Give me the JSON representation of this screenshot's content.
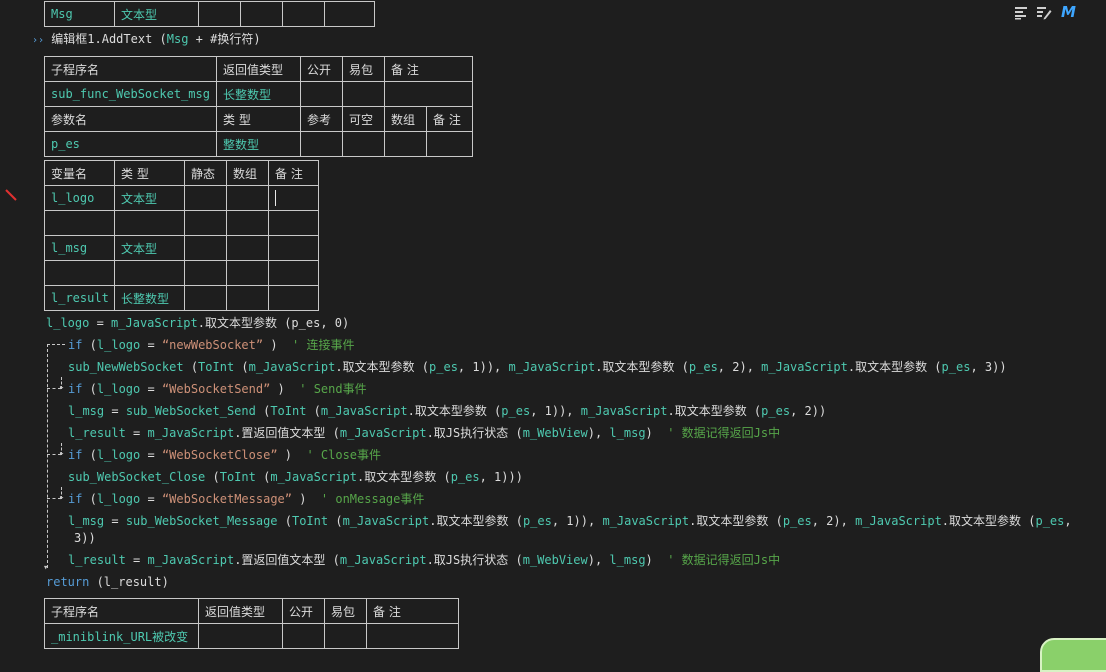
{
  "top_table": {
    "name": "Msg",
    "type": "文本型"
  },
  "addtext_line": {
    "arrow": "››",
    "obj": "编辑框1.AddText",
    "open": " (",
    "arg1": "Msg",
    "plus": " + ",
    "arg2": "#换行符",
    "close": ")"
  },
  "sub_table": {
    "headers": [
      "子程序名",
      "返回值类型",
      "公开",
      "易包",
      "备 注"
    ],
    "name": "sub_func_WebSocket_msg",
    "return_type": "长整数型",
    "param_headers": [
      "参数名",
      "类 型",
      "参考",
      "可空",
      "数组",
      "备 注"
    ],
    "param_name": "p_es",
    "param_type": "整数型"
  },
  "var_table": {
    "headers": [
      "变量名",
      "类 型",
      "静态",
      "数组",
      "备 注"
    ],
    "rows": [
      {
        "name": "l_logo",
        "type": "文本型"
      },
      {
        "name": "",
        "type": ""
      },
      {
        "name": "l_msg",
        "type": "文本型"
      },
      {
        "name": "",
        "type": ""
      },
      {
        "name": "l_result",
        "type": "长整数型"
      }
    ]
  },
  "code": {
    "l1": {
      "v": "l_logo",
      "eq": " = ",
      "obj": "m_JavaScript",
      "m": ".取文本型参数",
      "args": " (p_es, 0)"
    },
    "l2": {
      "kw": "if",
      "open": " (",
      "v": "l_logo",
      "eq": " = ",
      "s": "“newWebSocket”",
      "close": " ) ",
      "c": " ' 连接事件"
    },
    "l3": {
      "a": "sub_NewWebSocket",
      "b": " (",
      "c": "ToInt",
      "d": " (",
      "e": "m_JavaScript",
      "f": ".取文本型参数 (",
      "g": "p_es",
      "h": ", 1)), ",
      "i": "m_JavaScript",
      "j": ".取文本型参数 (",
      "k": "p_es",
      "l": ", 2), ",
      "m": "m_JavaScript",
      "n": ".取文本型参数 (",
      "o": "p_es",
      "p": ", 3))"
    },
    "l4": {
      "kw": "if",
      "open": " (",
      "v": "l_logo",
      "eq": " = ",
      "s": "“WebSocketSend”",
      "close": " ) ",
      "c": " ' Send事件"
    },
    "l5": {
      "a": "l_msg",
      "b": " = ",
      "c": "sub_WebSocket_Send",
      "d": " (",
      "e": "ToInt",
      "f": " (",
      "g": "m_JavaScript",
      "h": ".取文本型参数 (",
      "i": "p_es",
      "j": ", 1)), ",
      "k": "m_JavaScript",
      "l": ".取文本型参数 (",
      "m": "p_es",
      "n": ", 2))"
    },
    "l6": {
      "a": "l_result",
      "b": " = ",
      "c": "m_JavaScript",
      "d": ".置返回值文本型 (",
      "e": "m_JavaScript",
      "f": ".取JS执行状态 (",
      "g": "m_WebView",
      "h": "), ",
      "i": "l_msg",
      "j": ") ",
      "k": " ' 数据记得返回Js中"
    },
    "l7": {
      "kw": "if",
      "open": " (",
      "v": "l_logo",
      "eq": " = ",
      "s": "“WebSocketClose”",
      "close": " ) ",
      "c": " ' Close事件"
    },
    "l8": {
      "a": "sub_WebSocket_Close",
      "b": " (",
      "c": "ToInt",
      "d": " (",
      "e": "m_JavaScript",
      "f": ".取文本型参数 (",
      "g": "p_es",
      "h": ", 1)))"
    },
    "l9": {
      "kw": "if",
      "open": " (",
      "v": "l_logo",
      "eq": " = ",
      "s": "“WebSocketMessage”",
      "close": " ) ",
      "c": " ' onMessage事件"
    },
    "l10": {
      "a": "l_msg",
      "b": " = ",
      "c": "sub_WebSocket_Message",
      "d": " (",
      "e": "ToInt",
      "f": " (",
      "g": "m_JavaScript",
      "h": ".取文本型参数 (",
      "i": "p_es",
      "j": ", 1)), ",
      "k": "m_JavaScript",
      "l": ".取文本型参数 (",
      "m": "p_es",
      "n": ", 2), ",
      "o": "m_JavaScript",
      "p": ".取文本型参数 (",
      "q": "p_es",
      "r": ","
    },
    "l10b": "3))",
    "l11": {
      "a": "l_result",
      "b": " = ",
      "c": "m_JavaScript",
      "d": ".置返回值文本型 (",
      "e": "m_JavaScript",
      "f": ".取JS执行状态 (",
      "g": "m_WebView",
      "h": "), ",
      "i": "l_msg",
      "j": ") ",
      "k": " ' 数据记得返回Js中"
    },
    "l12": {
      "kw": "return",
      "args": " (l_result)"
    }
  },
  "sub_table2": {
    "headers": [
      "子程序名",
      "返回值类型",
      "公开",
      "易包",
      "备 注"
    ],
    "name": "_miniblink_URL被改变"
  },
  "toolbar": {
    "icons": [
      "align-icon",
      "edit-icon",
      "m-logo-icon"
    ],
    "logo_text": "M"
  }
}
